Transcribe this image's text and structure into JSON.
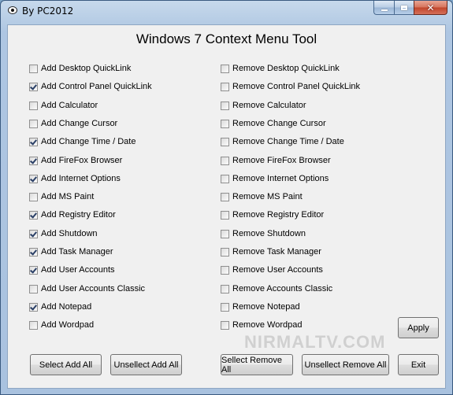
{
  "window": {
    "title": "By PC2012",
    "heading": "Windows 7 Context Menu Tool",
    "caption_buttons": {
      "minimize_icon": "minimize-icon",
      "maximize_icon": "maximize-icon",
      "close_icon": "close-icon",
      "close_glyph": "✕"
    },
    "accent_color": "#b4cbe4"
  },
  "add_options": [
    {
      "label": "Add Desktop QuickLink",
      "checked": false
    },
    {
      "label": "Add Control Panel QuickLink",
      "checked": true
    },
    {
      "label": "Add Calculator",
      "checked": false
    },
    {
      "label": "Add Change Cursor",
      "checked": false
    },
    {
      "label": "Add Change Time / Date",
      "checked": true
    },
    {
      "label": "Add FireFox Browser",
      "checked": true
    },
    {
      "label": "Add Internet Options",
      "checked": true
    },
    {
      "label": "Add MS Paint",
      "checked": false
    },
    {
      "label": "Add Registry Editor",
      "checked": true
    },
    {
      "label": "Add Shutdown",
      "checked": true
    },
    {
      "label": "Add Task Manager",
      "checked": true
    },
    {
      "label": "Add User Accounts",
      "checked": true
    },
    {
      "label": "Add User Accounts Classic",
      "checked": false
    },
    {
      "label": "Add Notepad",
      "checked": true
    },
    {
      "label": "Add Wordpad",
      "checked": false
    }
  ],
  "remove_options": [
    {
      "label": "Remove Desktop QuickLink",
      "checked": false
    },
    {
      "label": "Remove Control Panel QuickLink",
      "checked": false
    },
    {
      "label": "Remove Calculator",
      "checked": false
    },
    {
      "label": "Remove Change Cursor",
      "checked": false
    },
    {
      "label": "Remove Change Time / Date",
      "checked": false
    },
    {
      "label": "Remove FireFox Browser",
      "checked": false
    },
    {
      "label": "Remove Internet Options",
      "checked": false
    },
    {
      "label": "Remove MS Paint",
      "checked": false
    },
    {
      "label": "Remove Registry Editor",
      "checked": false
    },
    {
      "label": "Remove Shutdown",
      "checked": false
    },
    {
      "label": "Remove Task Manager",
      "checked": false
    },
    {
      "label": "Remove User Accounts",
      "checked": false
    },
    {
      "label": "Remove Accounts Classic",
      "checked": false
    },
    {
      "label": "Remove Notepad",
      "checked": false
    },
    {
      "label": "Remove Wordpad",
      "checked": false
    }
  ],
  "buttons": {
    "apply": "Apply",
    "select_add_all": "Select Add All",
    "unselect_add_all": "Unsellect Add All",
    "select_remove_all": "Sellect Remove All",
    "unselect_remove_all": "Unsellect Remove All",
    "exit": "Exit"
  },
  "watermark": "NIRMALTV.COM"
}
